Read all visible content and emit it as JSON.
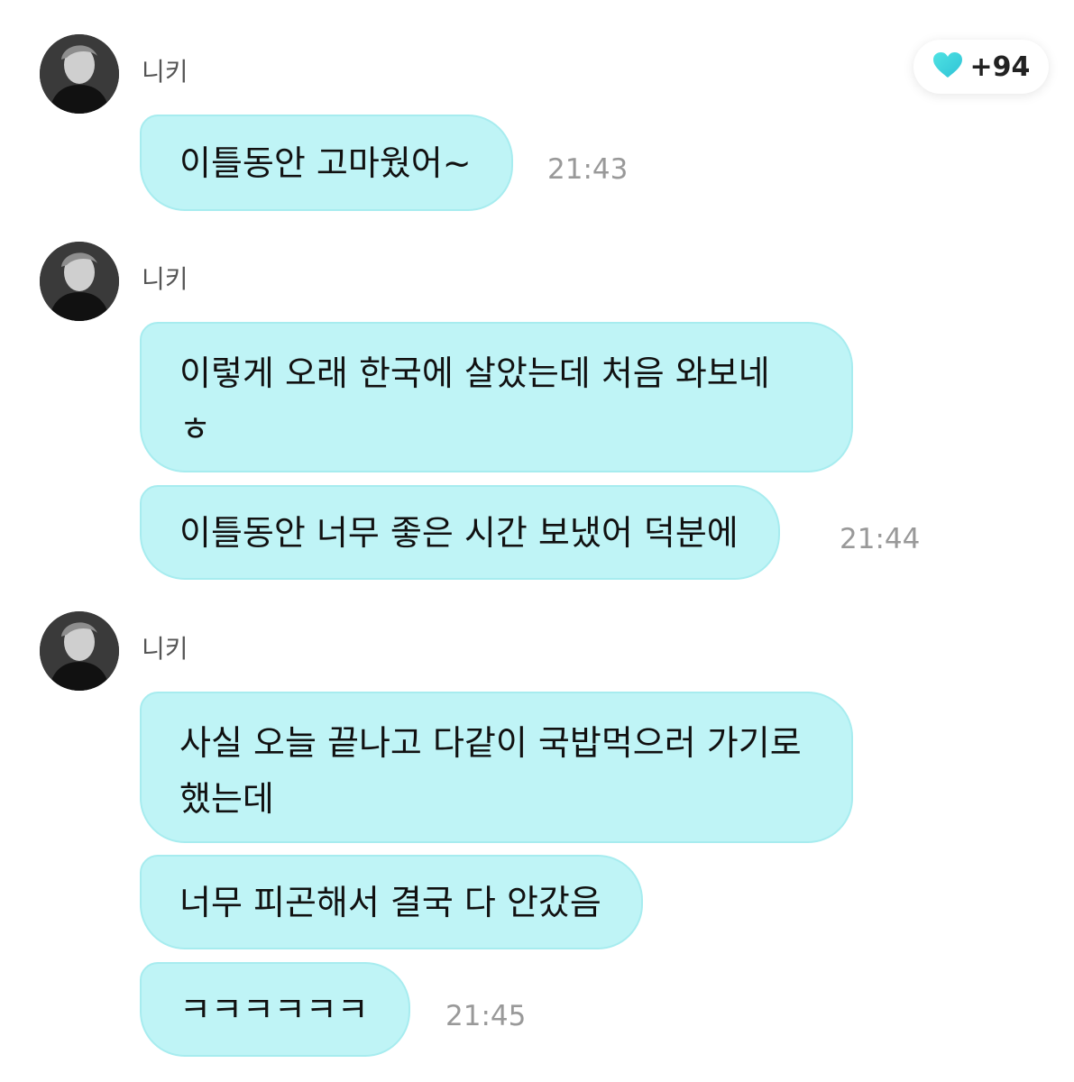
{
  "heart_badge": {
    "icon": "heart-icon",
    "color": "#3fd3dd",
    "count": "+94"
  },
  "messages": [
    {
      "sender": "니키",
      "bubbles": [
        "이틀동안 고마웠어~"
      ],
      "time": "21:43"
    },
    {
      "sender": "니키",
      "bubbles": [
        "이렇게 오래 한국에 살았는데 처음 와보네 ㅎ",
        "이틀동안 너무 좋은 시간 보냈어 덕분에"
      ],
      "time": "21:44"
    },
    {
      "sender": "니키",
      "bubbles": [
        "사실 오늘 끝나고 다같이 국밥먹으러 가기로 했는데",
        "너무 피곤해서 결국 다 안갔음",
        "ㅋㅋㅋㅋㅋㅋ"
      ],
      "time": "21:45"
    }
  ],
  "colors": {
    "bubble_fill": "#bff4f6",
    "bubble_border": "#a7ecef",
    "timestamp": "#999999"
  }
}
